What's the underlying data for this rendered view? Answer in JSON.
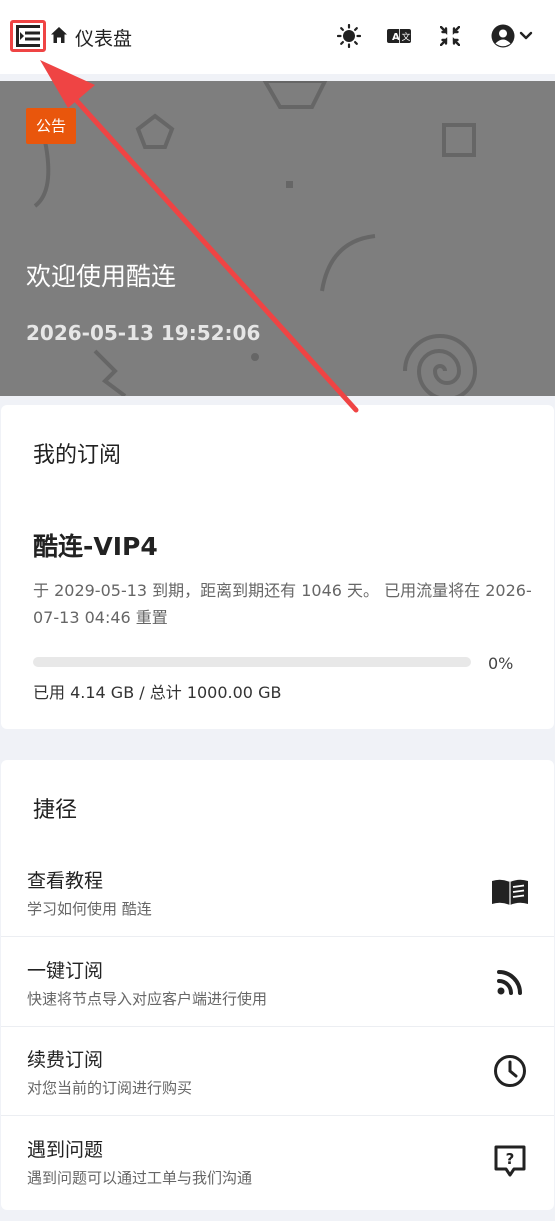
{
  "header": {
    "title": "仪表盘"
  },
  "banner": {
    "badge": "公告",
    "title": "欢迎使用酷连",
    "time": "2026-05-13 19:52:06"
  },
  "subscription": {
    "heading": "我的订阅",
    "plan_name": "酷连-VIP4",
    "description": "于 2029-05-13 到期，距离到期还有 1046 天。 已用流量将在 2026-07-13 04:46 重置",
    "progress_percent": 0,
    "progress_label": "0%",
    "usage": "已用 4.14 GB / 总计 1000.00 GB"
  },
  "shortcuts": {
    "heading": "捷径",
    "items": [
      {
        "title": "查看教程",
        "subtitle": "学习如何使用 酷连",
        "icon": "book-icon"
      },
      {
        "title": "一键订阅",
        "subtitle": "快速将节点导入对应客户端进行使用",
        "icon": "rss-icon"
      },
      {
        "title": "续费订阅",
        "subtitle": "对您当前的订阅进行购买",
        "icon": "clock-icon"
      },
      {
        "title": "遇到问题",
        "subtitle": "遇到问题可以通过工单与我们沟通",
        "icon": "help-chat-icon"
      }
    ]
  },
  "colors": {
    "accent": "#e9560c",
    "highlight": "#ef4444",
    "banner": "#7e7e7e"
  }
}
